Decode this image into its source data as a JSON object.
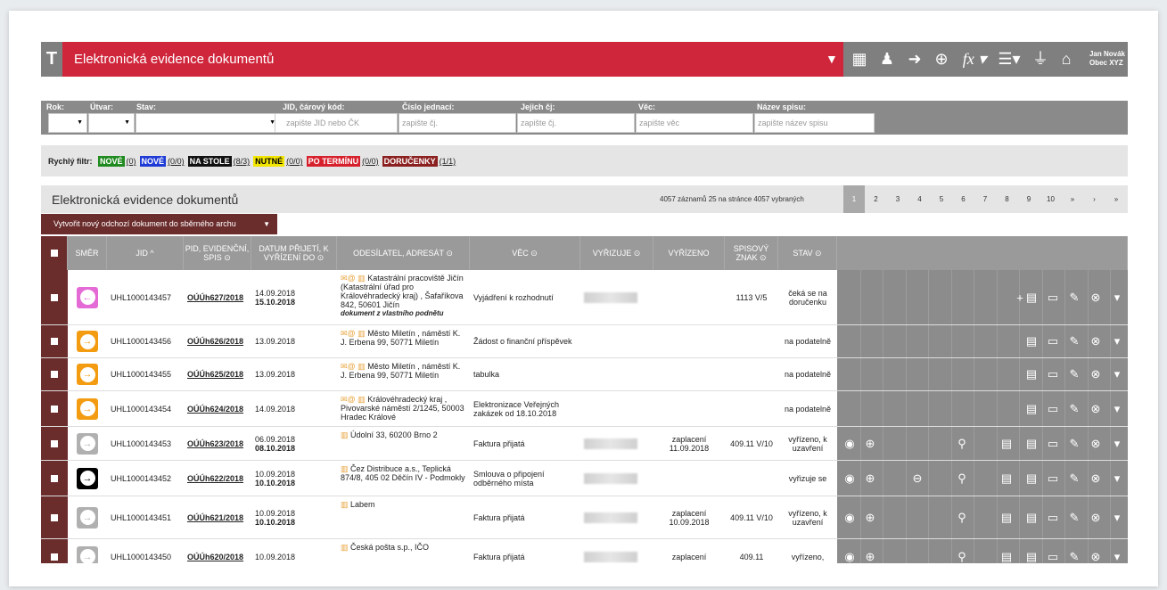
{
  "header": {
    "logo": "T",
    "title": "Elektronická evidence dokumentů",
    "user_name": "Jan Novák",
    "user_org": "Obec XYZ"
  },
  "filters": {
    "rok_label": "Rok:",
    "utvar_label": "Útvar:",
    "stav_label": "Stav:",
    "jid_label": "JID, čárový kód:",
    "jid_placeholder": "zapište JID nebo ČK",
    "cj_label": "Číslo jednací:",
    "cj_placeholder": "zapište čj.",
    "jejich_label": "Jejich čj:",
    "jejich_placeholder": "zapište čj.",
    "vec_label": "Věc:",
    "vec_placeholder": "zapište věc",
    "spis_label": "Název spisu:",
    "spis_placeholder": "zapište název spisu"
  },
  "quick_filter": {
    "label": "Rychlý filtr:",
    "items": [
      {
        "label": "NOVÉ",
        "count": "(0)",
        "bg": "#1f8a1f",
        "fg": "#ffffff"
      },
      {
        "label": "NOVÉ",
        "count": "(0/0)",
        "bg": "#1f3bd6",
        "fg": "#ffffff"
      },
      {
        "label": "NA STOLE",
        "count": "(8/3)",
        "bg": "#111111",
        "fg": "#ffffff"
      },
      {
        "label": "NUTNÉ",
        "count": "(0/0)",
        "bg": "#f2e600",
        "fg": "#000000"
      },
      {
        "label": "PO TERMÍNU",
        "count": "(0/0)",
        "bg": "#d6202c",
        "fg": "#ffffff"
      },
      {
        "label": "DORUČENKY",
        "count": "(1/1)",
        "bg": "#8b2020",
        "fg": "#ffffff"
      }
    ]
  },
  "list": {
    "title": "Elektronická evidence dokumentů",
    "info": "4057 záznamů   25 na stránce   4057 vybraných",
    "pages": [
      "1",
      "2",
      "3",
      "4",
      "5",
      "6",
      "7",
      "8",
      "9",
      "10",
      "»",
      "›",
      "»"
    ],
    "new_button": "Vytvořit nový odchozí dokument do sběrného archu"
  },
  "columns": {
    "smer": "SMĚR",
    "jid": "JID ^",
    "pid": "PID, EVIDENČNÍ, SPIS ⊙",
    "datum": "DATUM PŘIJETÍ, K VYŘÍZENÍ DO ⊙",
    "odesilatel": "ODESÍLATEL, ADRESÁT ⊙",
    "vec": "VĚC ⊙",
    "vyrizuje": "VYŘIZUJE ⊙",
    "vyrizeno": "VYŘÍZENO",
    "znak": "SPISOVÝ ZNAK ⊙",
    "stav": "STAV ⊙"
  },
  "rows": [
    {
      "dir_color": "#e46ad6",
      "dir_symbol": "←",
      "jid": "UHL1000143457",
      "pid": "OÚÚh627/2018",
      "date1": "14.09.2018",
      "date2": "15.10.2018",
      "sender": "Katastrální pracoviště Jičín (Katastrální úřad pro Královéhradecký kraj) , Šafaříkova 842, 50601 Jičín",
      "sender_note": "dokument z vlastního podnětu",
      "subject": "Vyjádření k rozhodnutí",
      "vyrizeno": "",
      "znak": "1113 V/5",
      "stav": "čeká se na doručenku"
    },
    {
      "dir_color": "#f39c12",
      "dir_symbol": "→",
      "jid": "UHL1000143456",
      "pid": "OÚÚh626/2018",
      "date1": "13.09.2018",
      "date2": "",
      "sender": "Město Miletín , náměstí K. J. Erbena 99, 50771 Miletín",
      "sender_note": "",
      "subject": "Žádost o finanční příspěvek",
      "vyrizeno": "",
      "znak": "",
      "stav": "na podatelně"
    },
    {
      "dir_color": "#f39c12",
      "dir_symbol": "→",
      "jid": "UHL1000143455",
      "pid": "OÚÚh625/2018",
      "date1": "13.09.2018",
      "date2": "",
      "sender": "Město Miletín , náměstí K. J. Erbena 99, 50771 Miletín",
      "sender_note": "",
      "subject": "tabulka",
      "vyrizeno": "",
      "znak": "",
      "stav": "na podatelně"
    },
    {
      "dir_color": "#f39c12",
      "dir_symbol": "→",
      "jid": "UHL1000143454",
      "pid": "OÚÚh624/2018",
      "date1": "14.09.2018",
      "date2": "",
      "sender": "Královéhradecký kraj , Pivovarské náměstí 2/1245, 50003 Hradec Králové",
      "sender_note": "",
      "subject": "Elektronizace Veřejných zakázek od 18.10.2018",
      "vyrizeno": "",
      "znak": "",
      "stav": "na podatelně"
    },
    {
      "dir_color": "#b0b0b0",
      "dir_symbol": "→",
      "jid": "UHL1000143453",
      "pid": "OÚÚh623/2018",
      "date1": "06.09.2018",
      "date2": "08.10.2018",
      "sender": "Údolní 33, 60200 Brno 2",
      "sender_note": "",
      "subject": "Faktura přijatá",
      "vyrizeno": "zaplacení 11.09.2018",
      "znak": "409.11 V/10",
      "stav": "vyřízeno, k uzavření"
    },
    {
      "dir_color": "#000000",
      "dir_symbol": "→",
      "jid": "UHL1000143452",
      "pid": "OÚÚh622/2018",
      "date1": "10.09.2018",
      "date2": "10.10.2018",
      "sender": "Čez Distribuce a.s., Teplická 874/8, 405 02 Děčín IV - Podmokly",
      "sender_note": "",
      "subject": "Smlouva o připojení odběrného místa",
      "vyrizeno": "",
      "znak": "",
      "stav": "vyřizuje se"
    },
    {
      "dir_color": "#b0b0b0",
      "dir_symbol": "→",
      "jid": "UHL1000143451",
      "pid": "OÚÚh621/2018",
      "date1": "10.09.2018",
      "date2": "10.10.2018",
      "sender": "Labem",
      "sender_note": "",
      "subject": "Faktura přijatá",
      "vyrizeno": "zaplacení 10.09.2018",
      "znak": "409.11 V/10",
      "stav": "vyřízeno, k uzavření"
    },
    {
      "dir_color": "#b0b0b0",
      "dir_symbol": "→",
      "jid": "UHL1000143450",
      "pid": "OÚÚh620/2018",
      "date1": "10.09.2018",
      "date2": "",
      "sender": "Česká pošta s.p., IČO",
      "sender_note": "",
      "subject": "Faktura přijatá",
      "vyrizeno": "zaplacení",
      "znak": "409.11",
      "stav": "vyřízeno,"
    }
  ]
}
